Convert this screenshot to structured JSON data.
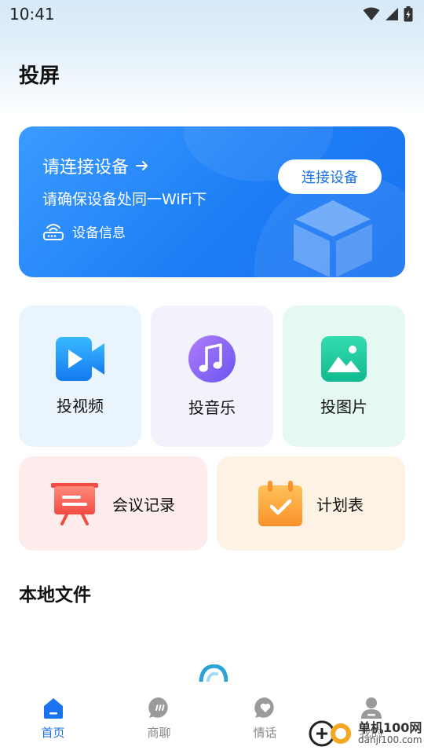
{
  "status_bar": {
    "time": "10:41"
  },
  "page": {
    "title": "投屏"
  },
  "banner": {
    "title": "请连接设备",
    "subtitle": "请确保设备处同一WiFi下",
    "device_info": "设备信息",
    "connect_button": "连接设备"
  },
  "features": {
    "video": "投视频",
    "music": "投音乐",
    "image": "投图片",
    "meeting": "会议记录",
    "plan": "计划表"
  },
  "local_files": {
    "title": "本地文件"
  },
  "nav": {
    "items": [
      {
        "label": "首页",
        "icon": "home-icon",
        "active": true
      },
      {
        "label": "商聊",
        "icon": "chat-icon",
        "active": false
      },
      {
        "label": "情话",
        "icon": "heart-chat-icon",
        "active": false
      },
      {
        "label": "我的",
        "icon": "user-icon",
        "active": false
      }
    ]
  },
  "watermark": {
    "main": "单机100网",
    "sub": "danji100.com"
  },
  "colors": {
    "accent": "#1a73ef",
    "banner": "#1b7cf5",
    "tile_video_bg": "#e9f4fd",
    "tile_music_bg": "#f2f2fc",
    "tile_image_bg": "#e6f8f2",
    "tile_meeting_bg": "#fdeceb",
    "tile_plan_bg": "#fdf2e3"
  }
}
